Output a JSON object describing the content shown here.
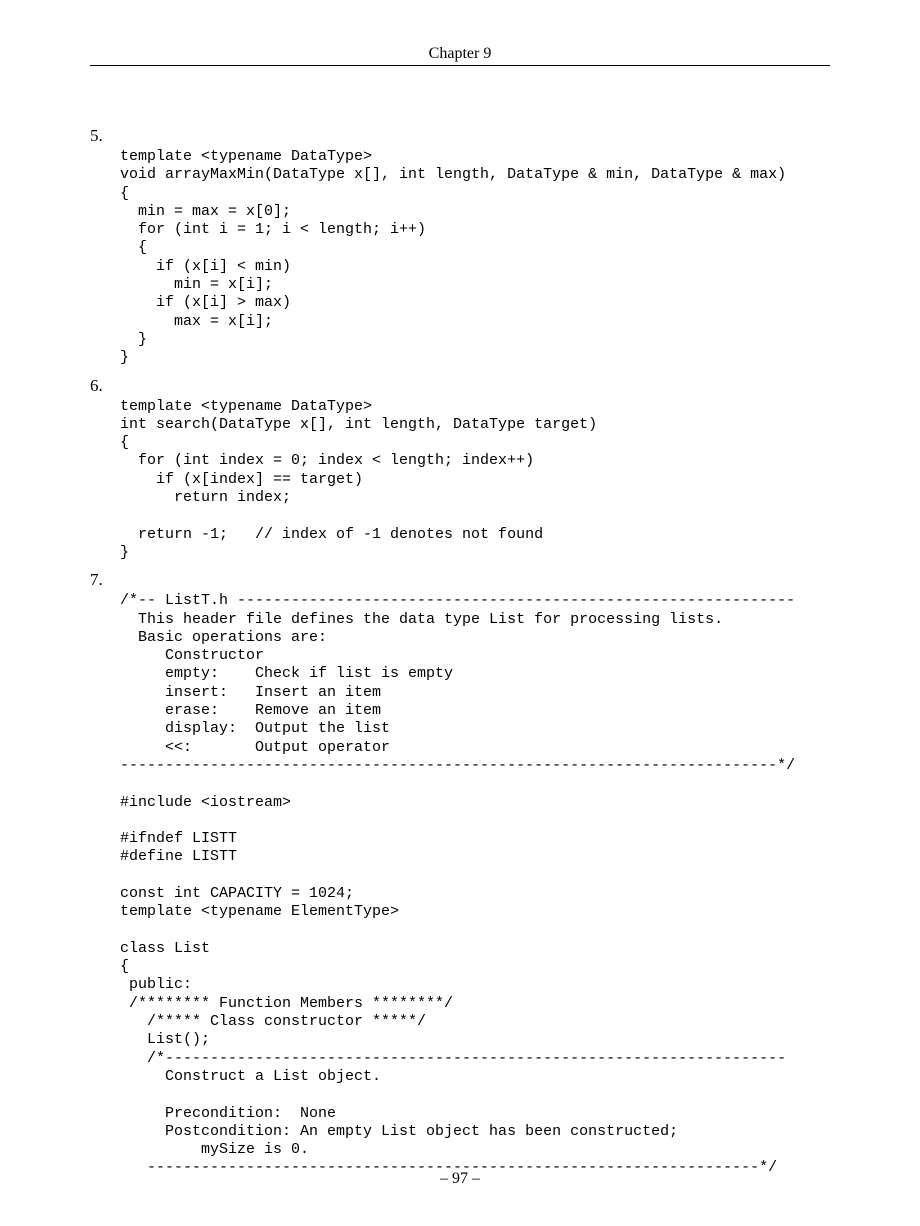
{
  "header": "Chapter 9",
  "footer": "– 97 –",
  "items": [
    {
      "num": "5.",
      "code": "template <typename DataType>\nvoid arrayMaxMin(DataType x[], int length, DataType & min, DataType & max)\n{\n  min = max = x[0];\n  for (int i = 1; i < length; i++)\n  {\n    if (x[i] < min)\n      min = x[i];\n    if (x[i] > max)\n      max = x[i];\n  }\n}"
    },
    {
      "num": "6.",
      "code": "template <typename DataType>\nint search(DataType x[], int length, DataType target)\n{\n  for (int index = 0; index < length; index++)\n    if (x[index] == target)\n      return index;\n\n  return -1;   // index of -1 denotes not found\n}"
    },
    {
      "num": "7.",
      "code": "/*-- ListT.h --------------------------------------------------------------\n  This header file defines the data type List for processing lists.\n  Basic operations are:\n     Constructor\n     empty:    Check if list is empty\n     insert:   Insert an item\n     erase:    Remove an item\n     display:  Output the list\n     <<:       Output operator\n-------------------------------------------------------------------------*/\n\n#include <iostream>\n\n#ifndef LISTT\n#define LISTT\n\nconst int CAPACITY = 1024;\ntemplate <typename ElementType>\n\nclass List\n{\n public:\n /******** Function Members ********/\n   /***** Class constructor *****/\n   List();\n   /*---------------------------------------------------------------------\n     Construct a List object.\n\n     Precondition:  None\n     Postcondition: An empty List object has been constructed;\n         mySize is 0.\n   --------------------------------------------------------------------*/"
    }
  ]
}
